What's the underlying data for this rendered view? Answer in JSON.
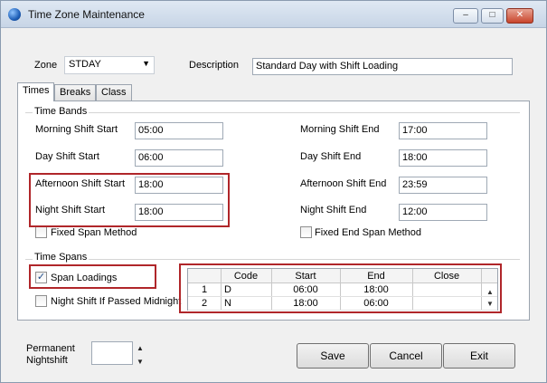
{
  "window": {
    "title": "Time Zone Maintenance"
  },
  "header": {
    "zone_label": "Zone",
    "zone_value": "STDAY",
    "description_label": "Description",
    "description_value": "Standard Day with Shift Loading"
  },
  "tabs": [
    {
      "label": "Times",
      "active": true
    },
    {
      "label": "Breaks"
    },
    {
      "label": "Class"
    }
  ],
  "time_bands": {
    "title": "Time Bands",
    "morning_start_label": "Morning Shift Start",
    "morning_start_value": "05:00",
    "morning_end_label": "Morning Shift End",
    "morning_end_value": "17:00",
    "day_start_label": "Day Shift Start",
    "day_start_value": "06:00",
    "day_end_label": "Day Shift End",
    "day_end_value": "18:00",
    "afternoon_start_label": "Afternoon Shift Start",
    "afternoon_start_value": "18:00",
    "afternoon_end_label": "Afternoon Shift End",
    "afternoon_end_value": "23:59",
    "night_start_label": "Night Shift Start",
    "night_start_value": "18:00",
    "night_end_label": "Night Shift End",
    "night_end_value": "12:00",
    "fixed_span_label": "Fixed Span Method",
    "fixed_end_span_label": "Fixed End Span Method"
  },
  "time_spans": {
    "title": "Time Spans",
    "span_loadings_label": "Span Loadings",
    "span_loadings_checked": true,
    "night_shift_label": "Night Shift If Passed Midnight",
    "grid": {
      "columns": [
        "Code",
        "Start",
        "End",
        "Close"
      ],
      "rows": [
        {
          "num": "1",
          "code": "D",
          "start": "06:00",
          "end": "18:00",
          "close": ""
        },
        {
          "num": "2",
          "code": "N",
          "start": "18:00",
          "end": "06:00",
          "close": ""
        }
      ]
    }
  },
  "footer": {
    "permanent_line1": "Permanent",
    "permanent_line2": "Nightshift",
    "save_label": "Save",
    "cancel_label": "Cancel",
    "exit_label": "Exit"
  },
  "colors": {
    "highlight": "#b0262a",
    "titlebar": "#c7d5e6"
  }
}
